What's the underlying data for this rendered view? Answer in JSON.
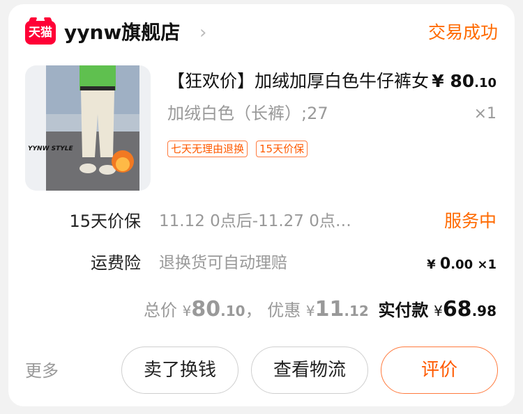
{
  "shop": {
    "logo_text": "天猫",
    "name": "yynw旗舰店",
    "chevron": "›",
    "order_status": "交易成功"
  },
  "product": {
    "image_caption": "YYNW STYLE",
    "title": "【狂欢价】加绒加厚白色牛仔裤女",
    "price_symbol": "¥",
    "price_int": "80",
    "price_dec": ".10",
    "sku": "加绒白色（长裤）;27",
    "qty": "×1",
    "tags": [
      "七天无理由退换",
      "15天价保"
    ]
  },
  "services": [
    {
      "label": "15天价保",
      "desc": "11.12 0点后-11.27 0点…",
      "status": "服务中"
    },
    {
      "label": "运费险",
      "desc": "退换货可自动理赔",
      "price_symbol": "¥",
      "price_int": "0",
      "price_dec": ".00",
      "qty": "×1"
    }
  ],
  "totals": {
    "total_label": "总价",
    "total_symbol": "¥",
    "total_int": "80",
    "total_dec": ".10",
    "sep": "，",
    "discount_label": "优惠",
    "discount_symbol": "¥",
    "discount_int": "11",
    "discount_dec": ".12",
    "paid_label": "实付款",
    "paid_symbol": "¥",
    "paid_int": "68",
    "paid_dec": ".98"
  },
  "actions": {
    "more": "更多",
    "sell": "卖了换钱",
    "track": "查看物流",
    "review": "评价"
  },
  "colors": {
    "accent": "#ff6a00",
    "tmall_red": "#ff0036",
    "muted": "#999999"
  }
}
